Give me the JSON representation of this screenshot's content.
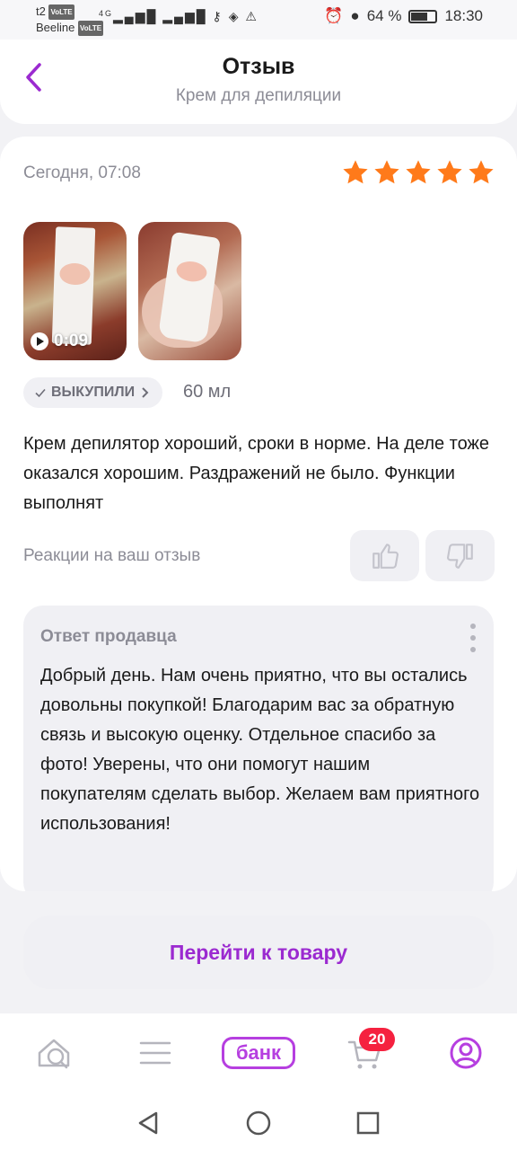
{
  "statusbar": {
    "carrier1": "t2",
    "carrier2": "Beeline",
    "volte": "VoLTE",
    "network": "4G",
    "battery": "64 %",
    "time": "18:30"
  },
  "header": {
    "title": "Отзыв",
    "subtitle": "Крем для депиляции"
  },
  "review": {
    "date": "Сегодня, 07:08",
    "rating": 5,
    "rating_max": 5,
    "video_duration": "0:09",
    "badge": "ВЫКУПИЛИ",
    "size": "60 мл",
    "text": "Крем депилятор хороший, сроки в норме. На деле тоже оказался хорошим. Раздражений не было. Функции выполнят"
  },
  "reactions": {
    "label": "Реакции на ваш отзыв"
  },
  "seller_reply": {
    "title": "Ответ продавца",
    "text": "Добрый день. Нам очень приятно, что вы остались довольны покупкой! Благодарим вас за обратную связь и высокую оценку. Отдельное спасибо за фото! Уверены, что они помогут нашим покупателям сделать выбор. Желаем вам приятного использования!"
  },
  "actions": {
    "goto_product": "Перейти к товару"
  },
  "tabbar": {
    "bank_label": "банк",
    "cart_count": "20"
  },
  "colors": {
    "accent": "#9b2ad0",
    "star": "#ff7a1a",
    "badge_red": "#f5213f"
  }
}
